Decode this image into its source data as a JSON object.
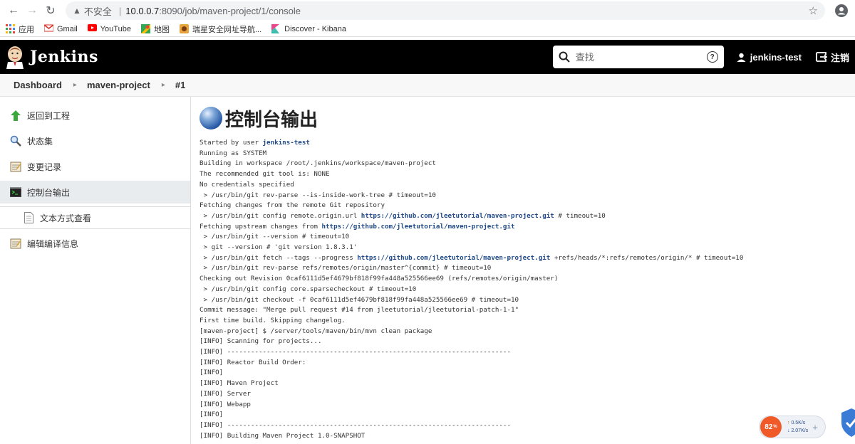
{
  "browser": {
    "back_icon": "back-arrow-icon",
    "insecure_label": "不安全",
    "url_host": "10.0.0.7",
    "url_path": ":8090/job/maven-project/1/console"
  },
  "bookmarks": [
    {
      "label": "应用",
      "icon": "apps-grid-icon"
    },
    {
      "label": "Gmail",
      "icon": "gmail-icon"
    },
    {
      "label": "YouTube",
      "icon": "youtube-icon"
    },
    {
      "label": "地图",
      "icon": "maps-icon"
    },
    {
      "label": "瑞星安全网址导航...",
      "icon": "rising-icon"
    },
    {
      "label": "Discover - Kibana",
      "icon": "kibana-icon"
    }
  ],
  "header": {
    "title": "Jenkins",
    "search_placeholder": "查找",
    "user": "jenkins-test",
    "logout": "注销"
  },
  "breadcrumb": [
    "Dashboard",
    "maven-project",
    "#1"
  ],
  "sidebar": [
    {
      "label": "返回到工程",
      "icon": "up-arrow-icon"
    },
    {
      "label": "状态集",
      "icon": "magnifier-icon"
    },
    {
      "label": "变更记录",
      "icon": "notepad-icon"
    },
    {
      "label": "控制台输出",
      "icon": "terminal-icon"
    },
    {
      "label": "文本方式查看",
      "icon": "document-icon"
    },
    {
      "label": "编辑编译信息",
      "icon": "notepad-icon"
    }
  ],
  "page_title": "控制台输出",
  "console": {
    "l0_pre": "Started by user ",
    "l0_link": "jenkins-test",
    "l1": "Running as SYSTEM",
    "l2": "Building in workspace /root/.jenkins/workspace/maven-project",
    "l3": "The recommended git tool is: NONE",
    "l4": "No credentials specified",
    "l5": " > /usr/bin/git rev-parse --is-inside-work-tree # timeout=10",
    "l6": "Fetching changes from the remote Git repository",
    "l7_pre": " > /usr/bin/git config remote.origin.url ",
    "l7_link": "https://github.com/jleetutorial/maven-project.git",
    "l7_post": " # timeout=10",
    "l8_pre": "Fetching upstream changes from ",
    "l8_link": "https://github.com/jleetutorial/maven-project.git",
    "l9": " > /usr/bin/git --version # timeout=10",
    "l10": " > git --version # 'git version 1.8.3.1'",
    "l11_pre": " > /usr/bin/git fetch --tags --progress ",
    "l11_link": "https://github.com/jleetutorial/maven-project.git",
    "l11_post": " +refs/heads/*:refs/remotes/origin/* # timeout=10",
    "l12": " > /usr/bin/git rev-parse refs/remotes/origin/master^{commit} # timeout=10",
    "l13": "Checking out Revision 0caf6111d5ef4679bf818f99fa448a525566ee69 (refs/remotes/origin/master)",
    "l14": " > /usr/bin/git config core.sparsecheckout # timeout=10",
    "l15": " > /usr/bin/git checkout -f 0caf6111d5ef4679bf818f99fa448a525566ee69 # timeout=10",
    "l16": "Commit message: \"Merge pull request #14 from jleetutorial/jleetutorial-patch-1-1\"",
    "l17": "First time build. Skipping changelog.",
    "l18": "[maven-project] $ /server/tools/maven/bin/mvn clean package",
    "l19": "[INFO] Scanning for projects...",
    "l20": "[INFO] ------------------------------------------------------------------------",
    "l21": "[INFO] Reactor Build Order:",
    "l22": "[INFO]",
    "l23": "[INFO] Maven Project",
    "l24": "[INFO] Server",
    "l25": "[INFO] Webapp",
    "l26": "[INFO]",
    "l27": "[INFO] ------------------------------------------------------------------------",
    "l28": "[INFO] Building Maven Project 1.0-SNAPSHOT"
  },
  "speed_widget": {
    "percent": "82",
    "percent_unit": "%",
    "up_rate": "0.5K/s",
    "down_rate": "2.07K/s"
  }
}
